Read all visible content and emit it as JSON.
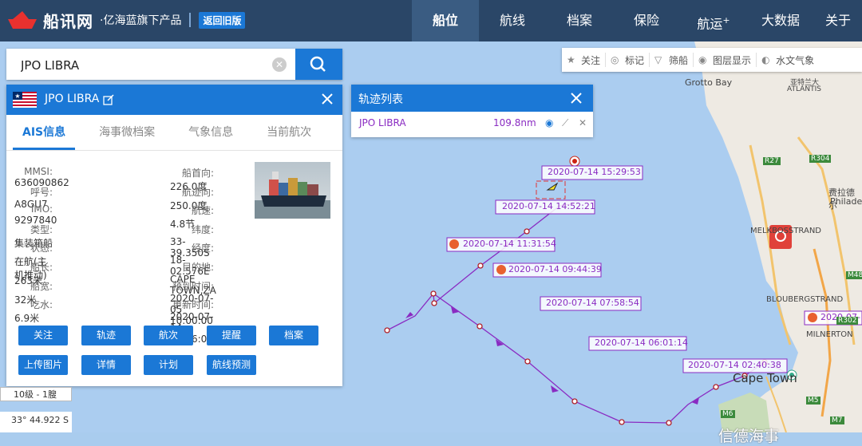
{
  "header": {
    "brand": "船讯网",
    "tagline": "·亿海蓝旗下产品",
    "old_version": "返回旧版",
    "nav": [
      "船位",
      "航线",
      "档案",
      "保险",
      "航运",
      "大数据",
      "关于"
    ],
    "nav_sup": "+"
  },
  "search": {
    "value": "JPO LIBRA"
  },
  "ship": {
    "name": "JPO LIBRA",
    "tabs": [
      "AIS信息",
      "海事微档案",
      "气象信息",
      "当前航次"
    ],
    "left": [
      {
        "label": "MMSI:",
        "value": "636090862"
      },
      {
        "label": "呼号:",
        "value": "A8GU7"
      },
      {
        "label": "IMO:",
        "value": "9297840"
      },
      {
        "label": "类型:",
        "value": "集装箱船"
      },
      {
        "label": "状态:",
        "value": "在航(主机推动)"
      },
      {
        "label": "船长:",
        "value": "263米"
      },
      {
        "label": "船宽:",
        "value": "32米"
      },
      {
        "label": "吃水:",
        "value": "6.9米"
      }
    ],
    "right": [
      {
        "label": "船首向:",
        "value": "226.0度"
      },
      {
        "label": "航迹向:",
        "value": "250.0度"
      },
      {
        "label": "航速:",
        "value": "4.8节"
      },
      {
        "label": "纬度:",
        "value": "33-39.350S"
      },
      {
        "label": "经度:",
        "value": "18-02.576E"
      },
      {
        "label": "目的地:",
        "value": "CAPE TOWN,ZA"
      },
      {
        "label": "预到时间:",
        "value": "2020-07-05 10:00:00"
      },
      {
        "label": "更新时间:",
        "value": "2020-07-14 16:56:05"
      }
    ],
    "buttons": [
      "关注",
      "轨迹",
      "航次",
      "提醒",
      "档案",
      "上传图片",
      "详情",
      "计划",
      "航线预测"
    ]
  },
  "track": {
    "title": "轨迹列表",
    "name": "JPO LIBRA",
    "distance": "109.8nm"
  },
  "toolbar": [
    "关注",
    "标记",
    "筛船",
    "图层显示",
    "水文气象"
  ],
  "map": {
    "scale": "10级 - 1膄",
    "coord": "33° 44.922 S",
    "labels": [
      "Grotto Bay",
      "亚特兰大",
      "ATLANTIS",
      "费拉德尔",
      "Philade",
      "MELKBOSSTRAND",
      "BLOUBERGSTRAND",
      "MILNERTON",
      "Cape Town",
      "R27",
      "R304",
      "R302",
      "M5",
      "M6",
      "M7",
      "M48"
    ],
    "track_times": [
      "2020-07-14 15:29:53",
      "2020-07-14 14:52:21",
      "2020-07-14 11:31:54",
      "2020-07-14 09:44:39",
      "2020-07-14 07:58:54",
      "2020-07-14 06:01:14",
      "2020-07-14 02:40:38",
      "2020-07-"
    ]
  },
  "watermark": "信德海事",
  "colors": {
    "topbar": "#2a4667",
    "accent": "#1b78d6",
    "track": "#8a2bc2"
  }
}
